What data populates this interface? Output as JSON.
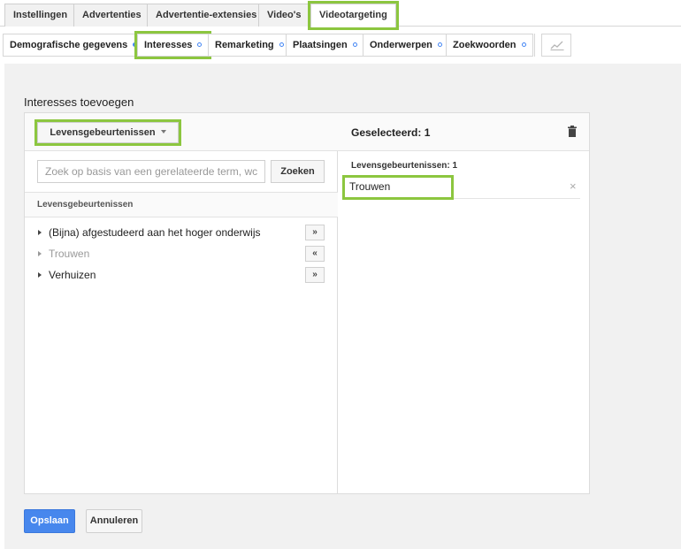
{
  "top_tabs": [
    {
      "label": "Instellingen"
    },
    {
      "label": "Advertenties"
    },
    {
      "label": "Advertentie-extensies"
    },
    {
      "label": "Video's"
    },
    {
      "label": "Videotargeting",
      "active": true
    }
  ],
  "sub_tabs": [
    {
      "label": "Demografische gegevens",
      "status": "filled"
    },
    {
      "label": "Interesses",
      "status": "ring",
      "active": true
    },
    {
      "label": "Remarketing",
      "status": "ring"
    },
    {
      "label": "Plaatsingen",
      "status": "ring"
    },
    {
      "label": "Onderwerpen",
      "status": "ring"
    },
    {
      "label": "Zoekwoorden",
      "status": "ring"
    }
  ],
  "chart_button_icon": "line-chart-icon",
  "section_title": "Interesses toevoegen",
  "left_panel": {
    "category_dropdown": "Levensgebeurtenissen",
    "search_placeholder": "Zoek op basis van een gerelateerde term, wc",
    "search_button": "Zoeken",
    "list_header": "Levensgebeurtenissen",
    "items": [
      {
        "label": "(Bijna) afgestudeerd aan het hoger onderwijs",
        "action": "»",
        "selected": false
      },
      {
        "label": "Trouwen",
        "action": "«",
        "selected": true
      },
      {
        "label": "Verhuizen",
        "action": "»",
        "selected": false
      }
    ]
  },
  "right_panel": {
    "title": "Geselecteerd: 1",
    "delete_icon": "trash-icon",
    "group_label": "Levensgebeurtenissen: 1",
    "selected_items": [
      {
        "label": "Trouwen",
        "remove": "×"
      }
    ]
  },
  "buttons": {
    "save": "Opslaan",
    "cancel": "Annuleren"
  },
  "colors": {
    "highlight": "#8cc63f",
    "primary": "#4787ed",
    "dot": "#4285f4"
  }
}
